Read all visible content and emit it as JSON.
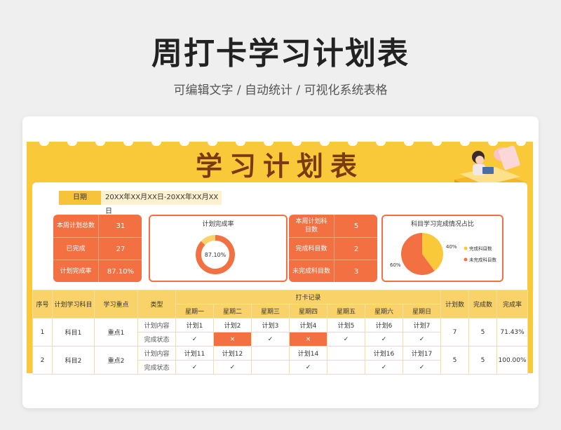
{
  "header": {
    "title": "周打卡学习计划表",
    "subtitle": "可编辑文字 / 自动统计 / 可视化系统表格"
  },
  "sheet": {
    "title": "学习计划表",
    "date_label": "日期",
    "date_value": "20XX年XX月XX日-20XX年XX月XX日"
  },
  "kpi_left": [
    {
      "label": "本周计划总数",
      "value": "31"
    },
    {
      "label": "已完成",
      "value": "27"
    },
    {
      "label": "计划完成率",
      "value": "87.10%"
    }
  ],
  "kpi_right": [
    {
      "label": "本周计划科目数",
      "value": "5"
    },
    {
      "label": "完成科目数",
      "value": "2"
    },
    {
      "label": "未完成科目数",
      "value": "3"
    }
  ],
  "chart_data": [
    {
      "type": "pie",
      "title": "计划完成率",
      "center_label": "87.10%",
      "values": [
        87.1,
        12.9
      ],
      "colors": [
        "#f37043",
        "#f9d36a"
      ]
    },
    {
      "type": "pie",
      "title": "科目学习完成情况占比",
      "labels": [
        "完成科目数",
        "未完成科目数"
      ],
      "values": [
        40,
        60
      ],
      "value_labels": [
        "40%",
        "60%"
      ],
      "colors": [
        "#f9c93a",
        "#f37043"
      ],
      "legend": "right"
    }
  ],
  "table": {
    "headers": {
      "no": "序号",
      "subject": "计划学习科目",
      "focus": "学习重点",
      "type": "类型",
      "record": "打卡记录",
      "count": "计划数",
      "done": "完成数",
      "rate": "完成率"
    },
    "days": [
      "星期一",
      "星期二",
      "星期三",
      "星期四",
      "星期五",
      "星期六",
      "星期日"
    ],
    "rows": [
      {
        "no": "1",
        "subject": "科目1",
        "focus": "重点1",
        "type1": "计划内容",
        "type2": "完成状态",
        "plans": [
          "计划1",
          "计划2",
          "计划3",
          "计划4",
          "计划5",
          "计划6",
          "计划7"
        ],
        "status": [
          "✓",
          "×",
          "✓",
          "×",
          "✓",
          "✓",
          "✓"
        ],
        "count": "7",
        "done": "5",
        "rate": "71.43%"
      },
      {
        "no": "2",
        "subject": "科目2",
        "focus": "重点2",
        "type1": "计划内容",
        "type2": "完成状态",
        "plans": [
          "计划11",
          "计划12",
          "",
          "计划14",
          "",
          "计划16",
          "计划17"
        ],
        "status": [
          "✓",
          "✓",
          "",
          "✓",
          "",
          "✓",
          "✓"
        ],
        "count": "5",
        "done": "5",
        "rate": "100.00%"
      }
    ]
  }
}
